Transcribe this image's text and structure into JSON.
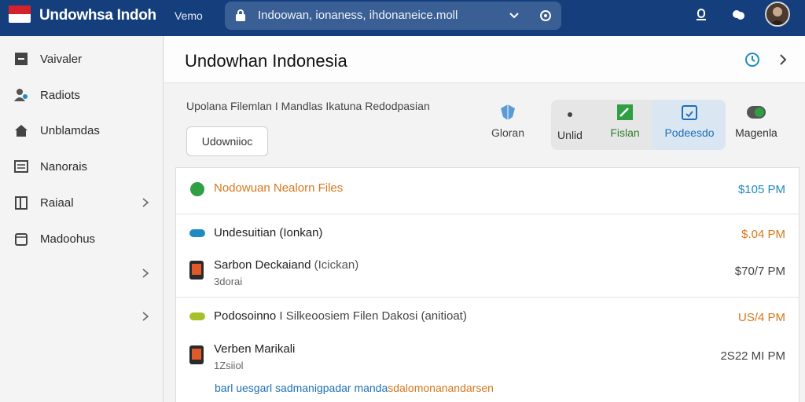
{
  "header": {
    "app_title": "Undowhsa Indoh",
    "menu_label": "Vemo",
    "url": "Indoowan, ionaness, ihdonaneice.moll"
  },
  "sidebar": {
    "items": [
      {
        "label": "Vaivaler",
        "icon": "square-icon"
      },
      {
        "label": "Radiots",
        "icon": "users-icon"
      },
      {
        "label": "Unblamdas",
        "icon": "home-icon"
      },
      {
        "label": "Nanorais",
        "icon": "list-icon"
      },
      {
        "label": "Raiaal",
        "icon": "document-icon"
      },
      {
        "label": "Madoohus",
        "icon": "calendar-icon"
      }
    ]
  },
  "main": {
    "page_title": "Undowhan Indonesia",
    "upload_desc": "Upolana Filemlan I Mandlas Ikatuna Redodpasian",
    "download_label": "Udowniioc",
    "tools": {
      "gloran": "Gloran",
      "unlid": "Unlid",
      "fislan": "Fislan",
      "podeesdo": "Podeesdo",
      "magenla": "Magenla"
    },
    "rows": [
      {
        "title": "Nodowuan Nealorn Files",
        "amount": "$105 PM"
      },
      {
        "title": "Undesuitian (Ionkan)",
        "amount": "$.04 PM"
      },
      {
        "title": "Sarbon Deckaiand",
        "title_suffix": "(Icickan)",
        "sub": "3dorai",
        "amount": "$70/7 PM"
      },
      {
        "title": "Podosoinno",
        "title_suffix": "I Silkeoosiem Filen Dakosi (anitioat)",
        "amount": "US/4 PM"
      },
      {
        "title": "Verben Marikali",
        "sub": "1Zsiiol",
        "amount": "2S22 MI PM"
      }
    ],
    "footer_link_a": "barl uesgarl sadmanigpadar manda",
    "footer_link_b": "sdalomonanandarsen"
  },
  "colors": {
    "topbar": "#153f7c",
    "orange": "#d9761c",
    "blue": "#1e8bc3",
    "green": "#2ea043",
    "dark": "#444444"
  }
}
